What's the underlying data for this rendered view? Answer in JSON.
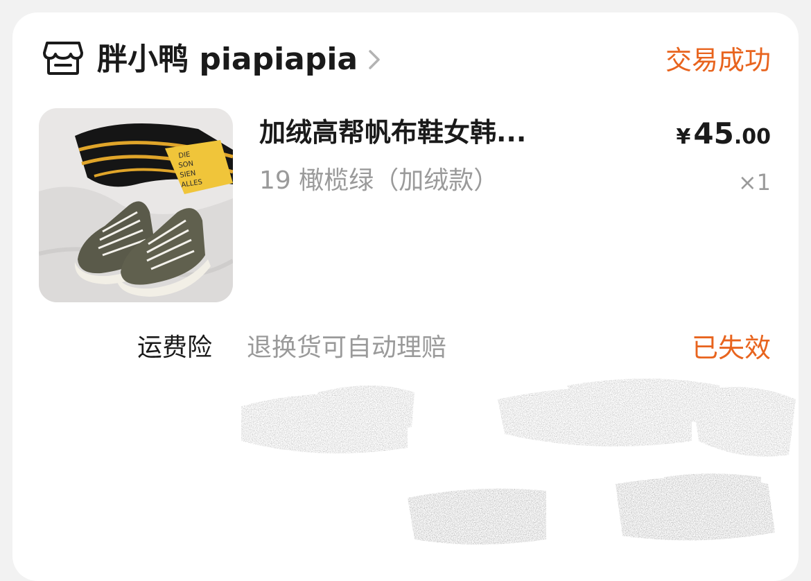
{
  "shop": {
    "icon": "store-icon",
    "name": "胖小鸭 piapiapia",
    "chevron_icon": "chevron-right-icon"
  },
  "order": {
    "status": "交易成功"
  },
  "product": {
    "image_icon": "product-thumbnail",
    "title": "加绒高帮帆布鞋女韩...",
    "sku": "19 橄榄绿（加绒款）",
    "price": {
      "currency": "¥",
      "integer": "45",
      "decimal": ".00"
    },
    "quantity": "×1"
  },
  "insurance": {
    "label": "运费险",
    "description": "退换货可自动理赔",
    "status": "已失效"
  },
  "colors": {
    "accent": "#e8641e",
    "text_primary": "#1a1a1a",
    "text_secondary": "#9a9a9a",
    "card_bg": "#ffffff"
  }
}
